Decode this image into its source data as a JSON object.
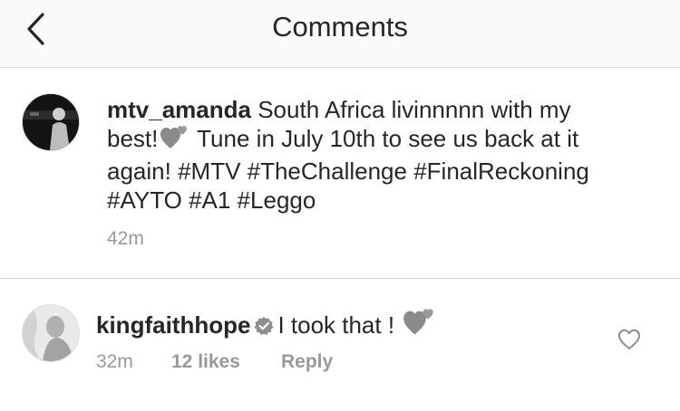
{
  "header": {
    "title": "Comments",
    "back_icon": "chevron-left-icon"
  },
  "caption": {
    "username": "mtv_amanda",
    "text_part1": "South Africa livinnnnn with my best!",
    "text_part2": "Tune in July 10th to see us back at it again! #MTV #TheChallenge #FinalReckoning #AYTO #A1 #Leggo",
    "emoji": "grey-heart-emoji",
    "time": "42m"
  },
  "comment": {
    "username": "kingfaithhope",
    "verified_icon": "verified-badge-icon",
    "text": "I took that !",
    "emoji": "grey-heart-emoji",
    "time": "32m",
    "likes": "12 likes",
    "reply": "Reply",
    "like_icon": "heart-outline-icon"
  }
}
